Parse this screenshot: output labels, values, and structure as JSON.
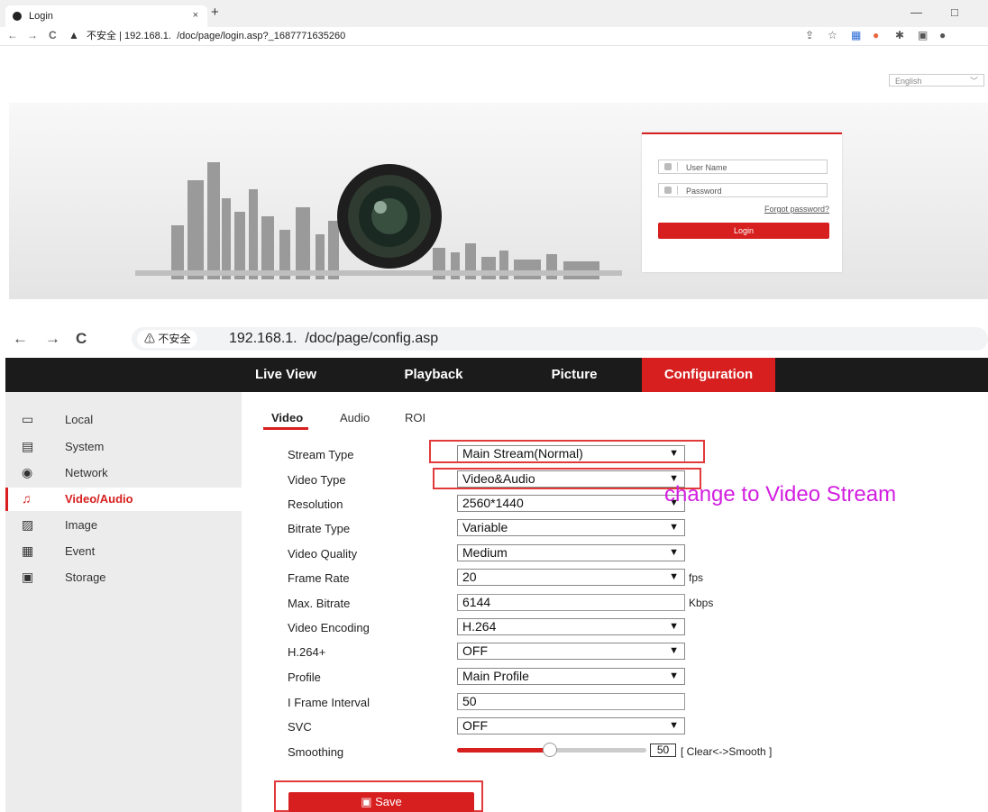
{
  "browser1": {
    "tab_title": "Login",
    "tab_close": "×",
    "new_tab": "+",
    "url": "不安全 | 192.168.1.  /doc/page/login.asp?_1687771635260",
    "nav_back": "←",
    "nav_forward": "→",
    "nav_reload": "C",
    "win_min": "—",
    "win_max": "□"
  },
  "login_page": {
    "language": "English",
    "username_placeholder": "User Name",
    "password_placeholder": "Password",
    "forgot_password": "Forgot password?",
    "login_button": "Login"
  },
  "browser2": {
    "nav_back": "←",
    "nav_forward": "→",
    "nav_reload": "C",
    "security_badge": "⚠ 不安全",
    "url": "192.168.1.  /doc/page/config.asp"
  },
  "topnav": {
    "items": [
      "Live View",
      "Playback",
      "Picture",
      "Configuration"
    ],
    "active": "Configuration"
  },
  "sidebar": {
    "items": [
      "Local",
      "System",
      "Network",
      "Video/Audio",
      "Image",
      "Event",
      "Storage"
    ],
    "active": "Video/Audio"
  },
  "subtabs": {
    "items": [
      "Video",
      "Audio",
      "ROI"
    ],
    "active": "Video"
  },
  "form": {
    "stream_type": {
      "label": "Stream Type",
      "value": "Main Stream(Normal)"
    },
    "video_type": {
      "label": "Video Type",
      "value": "Video&Audio"
    },
    "resolution": {
      "label": "Resolution",
      "value": "2560*1440"
    },
    "bitrate_type": {
      "label": "Bitrate Type",
      "value": "Variable"
    },
    "video_quality": {
      "label": "Video Quality",
      "value": "Medium"
    },
    "frame_rate": {
      "label": "Frame Rate",
      "value": "20",
      "unit": "fps"
    },
    "max_bitrate": {
      "label": "Max. Bitrate",
      "value": "6144",
      "unit": "Kbps"
    },
    "video_encoding": {
      "label": "Video Encoding",
      "value": "H.264"
    },
    "h264plus": {
      "label": "H.264+",
      "value": "OFF"
    },
    "profile": {
      "label": "Profile",
      "value": "Main Profile"
    },
    "i_frame_interval": {
      "label": "I Frame Interval",
      "value": "50"
    },
    "svc": {
      "label": "SVC",
      "value": "OFF"
    },
    "smoothing": {
      "label": "Smoothing",
      "value": "50",
      "level": 0.5,
      "hint": "[ Clear<->Smooth ]"
    },
    "save_button": "Save"
  },
  "annotation": {
    "text": "change to Video Stream",
    "color": "#d21fe0"
  },
  "colors": {
    "accent": "#d71f1f",
    "nav_bg": "#1b1b1b",
    "sidebar_bg": "#ececec"
  }
}
